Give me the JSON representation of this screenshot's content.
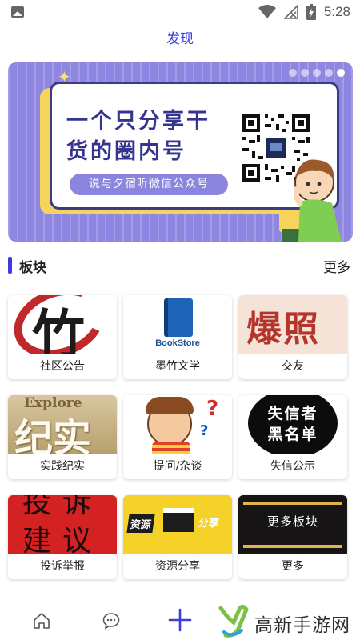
{
  "status_bar": {
    "time": "5:28"
  },
  "header": {
    "title": "发现"
  },
  "banner": {
    "headline_line1": "一个只分享干",
    "headline_line2": "货的圈内号",
    "subtitle": "说与夕宿听微信公众号",
    "slide_count": 5,
    "active_slide": 5
  },
  "section": {
    "title": "板块",
    "more_label": "更多"
  },
  "tiles": [
    {
      "label": "社区公告",
      "thumb_text": "竹"
    },
    {
      "label": "墨竹文学",
      "thumb_text": "BookStore"
    },
    {
      "label": "交友",
      "thumb_text": "爆照"
    },
    {
      "label": "实践纪实",
      "thumb_text_en": "Explore",
      "thumb_text": "纪实"
    },
    {
      "label": "提问/杂谈",
      "thumb_text": "?"
    },
    {
      "label": "失信公示",
      "thumb_text_line1": "失信者",
      "thumb_text_line2": "黑名单"
    },
    {
      "label": "投诉举报",
      "thumb_text": "投诉 建议 举报"
    },
    {
      "label": "资源分享",
      "thumb_text_a": "资源",
      "thumb_text_b": "分享"
    },
    {
      "label": "更多",
      "thumb_text": "更多板块"
    }
  ],
  "watermark": {
    "text": "高新手游网"
  },
  "colors": {
    "accent": "#3b3fd8",
    "banner_bg": "#8f86e2",
    "banner_text": "#35348f"
  }
}
